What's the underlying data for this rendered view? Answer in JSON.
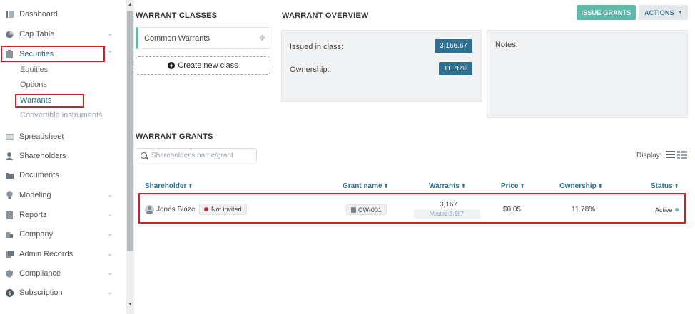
{
  "sidebar": {
    "items": [
      {
        "label": "Dashboard",
        "icon": "dashboard-icon"
      },
      {
        "label": "Cap Table",
        "icon": "pie-chart-icon"
      },
      {
        "label": "Securities",
        "icon": "securities-icon"
      },
      {
        "label": "Spreadsheet",
        "icon": "spreadsheet-icon"
      },
      {
        "label": "Shareholders",
        "icon": "person-icon"
      },
      {
        "label": "Documents",
        "icon": "folder-icon"
      },
      {
        "label": "Modeling",
        "icon": "lightbulb-icon"
      },
      {
        "label": "Reports",
        "icon": "report-icon"
      },
      {
        "label": "Company",
        "icon": "building-icon"
      },
      {
        "label": "Admin Records",
        "icon": "admin-records-icon"
      },
      {
        "label": "Compliance",
        "icon": "shield-icon"
      },
      {
        "label": "Subscription",
        "icon": "dollar-icon"
      }
    ],
    "securities_sub": [
      "Equities",
      "Options",
      "Warrants",
      "Convertible instruments"
    ]
  },
  "classes": {
    "title": "WARRANT CLASSES",
    "card_label": "Common Warrants",
    "create_label": "Create new class"
  },
  "overview": {
    "title": "WARRANT OVERVIEW",
    "issued_label": "Issued in class:",
    "issued_value": "3,166.67",
    "ownership_label": "Ownership:",
    "ownership_value": "11.78%",
    "notes_label": "Notes:"
  },
  "toolbar": {
    "issue_label": "ISSUE GRANTS",
    "actions_label": "ACTIONS"
  },
  "grants": {
    "title": "WARRANT GRANTS",
    "search_placeholder": "Shareholder's name/grant",
    "display_label": "Display:",
    "columns": [
      "Shareholder",
      "Grant name",
      "Warrants",
      "Price",
      "Ownership",
      "Status"
    ],
    "rows": [
      {
        "shareholder": "Jones Blaze",
        "invite_status": "Not invited",
        "grant_name": "CW-001",
        "warrants": "3,167",
        "vested": "Vested:3,167",
        "price": "$0.05",
        "ownership": "11.78%",
        "status": "Active"
      }
    ]
  },
  "colors": {
    "accent_teal": "#5fb8a8",
    "accent_blue": "#2f6f90",
    "highlight_red": "#d0202a"
  }
}
